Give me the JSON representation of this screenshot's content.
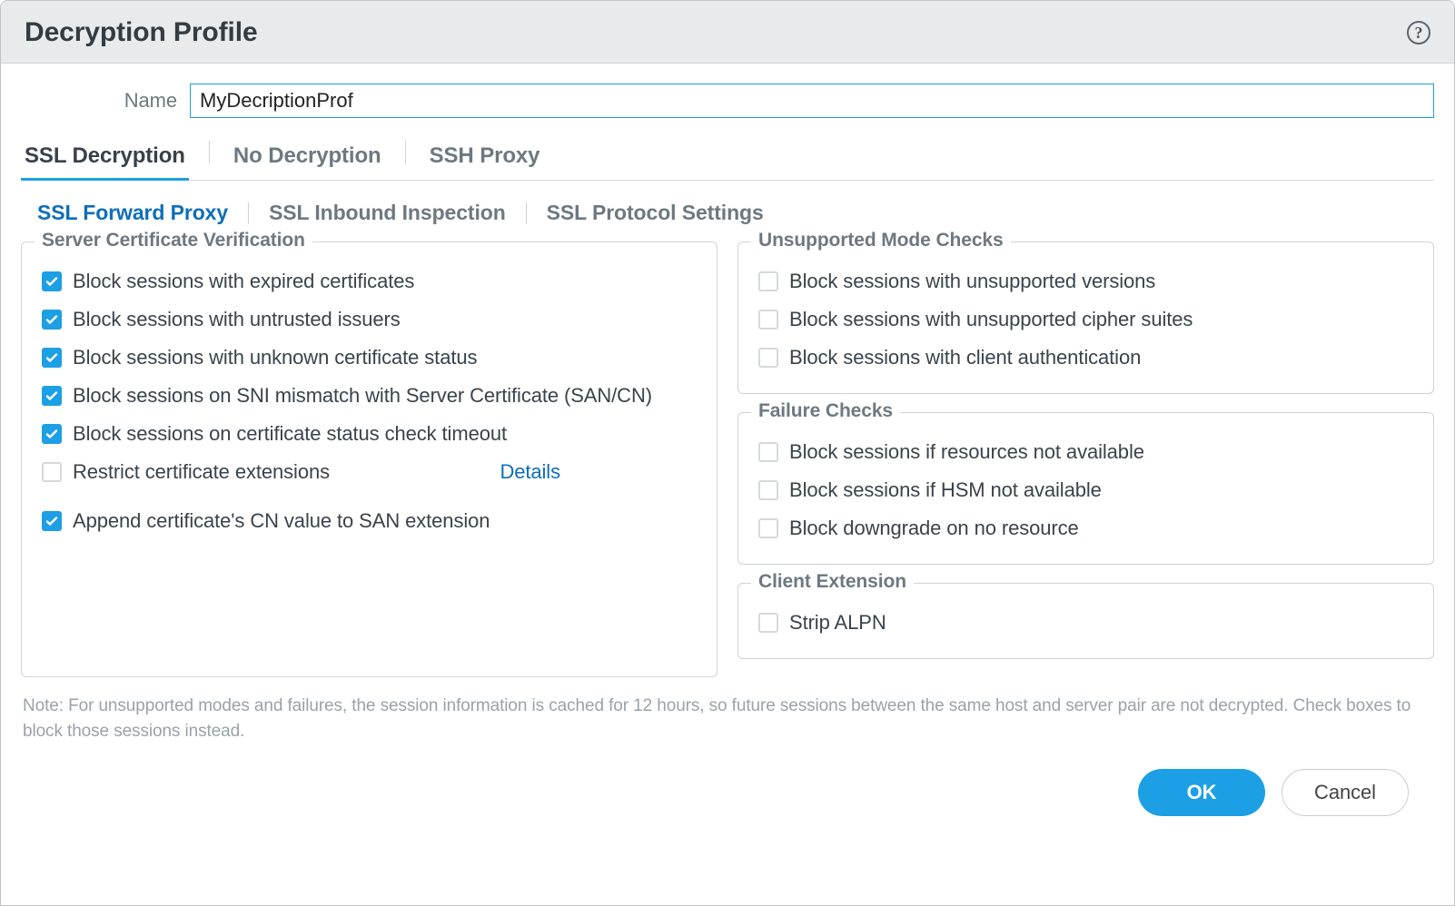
{
  "dialog": {
    "title": "Decryption Profile",
    "help_tooltip": "Help"
  },
  "name": {
    "label": "Name",
    "value": "MyDecriptionProf"
  },
  "top_tabs": [
    {
      "id": "ssl-decryption",
      "label": "SSL Decryption",
      "active": true
    },
    {
      "id": "no-decryption",
      "label": "No Decryption",
      "active": false
    },
    {
      "id": "ssh-proxy",
      "label": "SSH Proxy",
      "active": false
    }
  ],
  "sub_tabs": [
    {
      "id": "ssl-forward-proxy",
      "label": "SSL Forward Proxy",
      "active": true
    },
    {
      "id": "ssl-inbound-inspection",
      "label": "SSL Inbound Inspection",
      "active": false
    },
    {
      "id": "ssl-protocol-settings",
      "label": "SSL Protocol Settings",
      "active": false
    }
  ],
  "groups": {
    "server_cert": {
      "legend": "Server Certificate Verification",
      "items": [
        {
          "id": "expired",
          "label": "Block sessions with expired certificates",
          "checked": true
        },
        {
          "id": "untrusted",
          "label": "Block sessions with untrusted issuers",
          "checked": true
        },
        {
          "id": "unknown-status",
          "label": "Block sessions with unknown certificate status",
          "checked": true
        },
        {
          "id": "sni-mismatch",
          "label": "Block sessions on SNI mismatch with Server Certificate (SAN/CN)",
          "checked": true
        },
        {
          "id": "status-timeout",
          "label": "Block sessions on certificate status check timeout",
          "checked": true
        },
        {
          "id": "restrict-ext",
          "label": "Restrict certificate extensions",
          "checked": false,
          "details_link": "Details"
        },
        {
          "id": "append-cn-san",
          "label": "Append certificate's CN value to SAN extension",
          "checked": true
        }
      ]
    },
    "unsupported": {
      "legend": "Unsupported Mode Checks",
      "items": [
        {
          "id": "unsupported-versions",
          "label": "Block sessions with unsupported versions",
          "checked": false
        },
        {
          "id": "unsupported-ciphers",
          "label": "Block sessions with unsupported cipher suites",
          "checked": false
        },
        {
          "id": "client-auth",
          "label": "Block sessions with client authentication",
          "checked": false
        }
      ]
    },
    "failure": {
      "legend": "Failure Checks",
      "items": [
        {
          "id": "resources-na",
          "label": "Block sessions if resources not available",
          "checked": false
        },
        {
          "id": "hsm-na",
          "label": "Block sessions if HSM not available",
          "checked": false
        },
        {
          "id": "downgrade",
          "label": "Block downgrade on no resource",
          "checked": false
        }
      ]
    },
    "client_ext": {
      "legend": "Client Extension",
      "items": [
        {
          "id": "strip-alpn",
          "label": "Strip ALPN",
          "checked": false
        }
      ]
    }
  },
  "note": "Note: For unsupported modes and failures, the session information is cached for 12 hours, so future sessions between the same host and server pair are not decrypted. Check boxes to block those sessions instead.",
  "buttons": {
    "ok": "OK",
    "cancel": "Cancel"
  }
}
